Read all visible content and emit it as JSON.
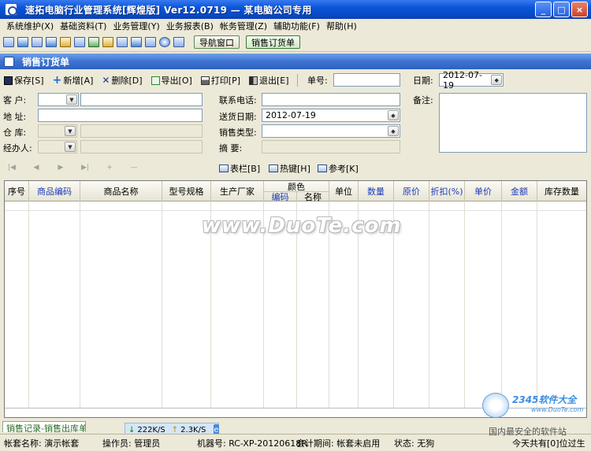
{
  "window": {
    "title": "速拓电脑行业管理系统[辉煌版] Ver12.0719 — 某电脑公司专用",
    "minimize": "_",
    "maximize": "□",
    "close": "×"
  },
  "menu": [
    "系统维护(X)",
    "基础资料(T)",
    "业务管理(Y)",
    "业务报表(B)",
    "帐务管理(Z)",
    "辅助功能(F)",
    "帮助(H)"
  ],
  "quick_buttons": {
    "nav_window": "导航窗口",
    "sales_order": "销售订货单"
  },
  "panel": {
    "title": "销售订货单"
  },
  "actions": {
    "save": "保存[S]",
    "add": "新增[A]",
    "delete": "删除[D]",
    "export": "导出[O]",
    "print": "打印[P]",
    "exit": "退出[E]",
    "doc_no_label": "单号:",
    "doc_no_value": "",
    "date_label": "日期:",
    "date_value": "2012-07-19"
  },
  "form": {
    "customer_label": "客  户:",
    "address_label": "地  址:",
    "warehouse_label": "仓  库:",
    "handler_label": "经办人:",
    "phone_label": "联系电话:",
    "delivery_date_label": "送货日期:",
    "delivery_date_value": "2012-07-19",
    "sales_type_label": "销售类型:",
    "summary_label": "摘   要:",
    "remarks_label": "备注:"
  },
  "tools": {
    "columns": "表栏[B]",
    "hotkeys": "热键[H]",
    "reference": "参考[K]"
  },
  "grid": {
    "columns": [
      "序号",
      "商品编码",
      "商品名称",
      "型号规格",
      "生产厂家",
      "颜色",
      "单位",
      "数量",
      "原价",
      "折扣(%)",
      "单价",
      "金额",
      "库存数量"
    ],
    "color_sub": [
      "编码",
      "名称"
    ]
  },
  "watermark": "www.DuoTe.com",
  "bottom_tab": "销售记录-销售出库单",
  "netmon": {
    "down": "222K/S",
    "up": "2.3K/S",
    "ie": "e"
  },
  "status": {
    "account": "帐套名称: 演示帐套",
    "operator": "操作员: 管理员",
    "machine": "机器号: RC-XP-20120618R",
    "period": "会计期间: 帐套未启用",
    "state": "状态: 无狗",
    "today": "今天共有[0]位过生"
  },
  "logo": {
    "brand": "2345软件大全",
    "url": "www.DuoTe.com",
    "safe": "国内最安全的软件站"
  }
}
